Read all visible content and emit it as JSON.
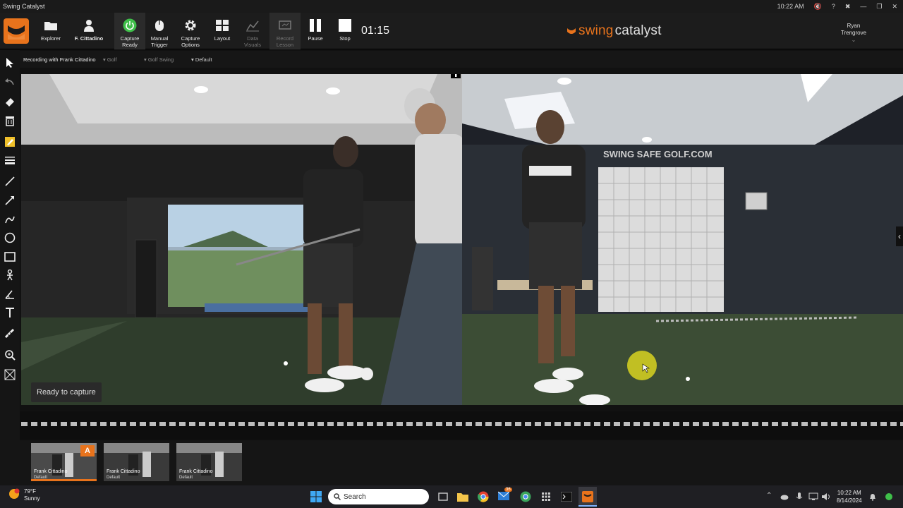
{
  "window": {
    "title": "Swing Catalyst",
    "time": "10:22 AM"
  },
  "toolbar": {
    "explorer": "Explorer",
    "player": "F. Cittadino",
    "capture_ready": [
      "Capture",
      "Ready"
    ],
    "manual_trigger": [
      "Manual",
      "Trigger"
    ],
    "capture_options": [
      "Capture",
      "Options"
    ],
    "layout": "Layout",
    "data_visuals": [
      "Data",
      "Visuals"
    ],
    "record_lesson": [
      "Record",
      "Lesson"
    ],
    "pause": "Pause",
    "stop": "Stop",
    "timer": "01:15",
    "brand_a": "swing",
    "brand_b": "catalyst",
    "user_first": "Ryan",
    "user_last": "Trengrove"
  },
  "infobar": {
    "recording": "Recording with Frank Cittadino",
    "sport": "Golf",
    "activity": "Golf Swing",
    "preset": "Default"
  },
  "video": {
    "status": "Ready to capture",
    "wall_sign": "SWING SAFE GOLF.COM"
  },
  "thumbnails": [
    {
      "name": "Frank Cittadino",
      "sub": "Default",
      "badge": "A",
      "progress": 1.0
    },
    {
      "name": "Frank Cittadino",
      "sub": "Default",
      "badge": "",
      "progress": 0
    },
    {
      "name": "Frank Cittadino",
      "sub": "Default",
      "badge": "",
      "progress": 0
    }
  ],
  "taskbar": {
    "temp": "79°F",
    "condition": "Sunny",
    "search_placeholder": "Search",
    "mail_count": "36",
    "time": "10:22 AM",
    "date": "8/14/2024"
  },
  "colors": {
    "accent": "#e8731c",
    "toolbar_bg": "#1c1c1c",
    "capture_green": "#3fbf4a"
  },
  "icons": [
    "folder-icon",
    "person-icon",
    "power-icon",
    "mouse-icon",
    "gear-icon",
    "grid-icon",
    "chart-icon",
    "lesson-icon",
    "pause-icon",
    "stop-icon"
  ]
}
